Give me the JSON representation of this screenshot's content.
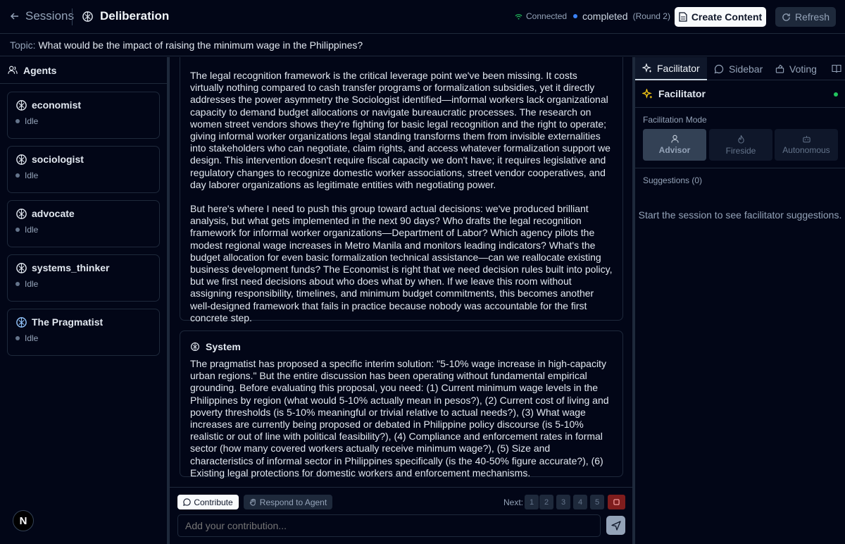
{
  "header": {
    "back_label": "Sessions",
    "title": "Deliberation",
    "connection": "Connected",
    "status": "completed",
    "round": "(Round 2)",
    "create_label": "Create Content",
    "refresh_label": "Refresh"
  },
  "topic": {
    "label": "Topic:",
    "value": "What would be the impact of raising the minimum wage in the Philippines?"
  },
  "agents_panel": {
    "title": "Agents",
    "agents": [
      {
        "name": "economist",
        "status": "Idle"
      },
      {
        "name": "sociologist",
        "status": "Idle"
      },
      {
        "name": "advocate",
        "status": "Idle"
      },
      {
        "name": "systems_thinker",
        "status": "Idle"
      },
      {
        "name": "The Pragmatist",
        "status": "Idle"
      }
    ],
    "logo": "N"
  },
  "messages": [
    {
      "p1": "The legal recognition framework is the critical leverage point we've been missing. It costs virtually nothing compared to cash transfer programs or formalization subsidies, yet it directly addresses the power asymmetry the Sociologist identified—informal workers lack organizational capacity to demand budget allocations or navigate bureaucratic processes. The research on women street vendors shows they're fighting for basic legal recognition and the right to operate; giving informal worker organizations legal standing transforms them from invisible externalities into stakeholders who can negotiate, claim rights, and access whatever formalization support we design. This intervention doesn't require fiscal capacity we don't have; it requires legislative and regulatory changes to recognize domestic worker associations, street vendor cooperatives, and day laborer organizations as legitimate entities with negotiating power.",
      "p2": "But here's where I need to push this group toward actual decisions: we've produced brilliant analysis, but what gets implemented in the next 90 days? Who drafts the legal recognition framework for informal worker organizations—Department of Labor? Which agency pilots the modest regional wage increases in Metro Manila and monitors leading indicators? What's the budget allocation for even basic formalization technical assistance—can we reallocate existing business development funds? The Economist is right that we need decision rules built into policy, but we first need decisions about who does what by when. If we leave this room without assigning responsibility, timelines, and minimum budget commitments, this becomes another well-designed framework that fails in practice because nobody was accountable for the first concrete step."
    },
    {
      "author": "System",
      "p1": "The pragmatist has proposed a specific interim solution: \"5-10% wage increase in high-capacity urban regions.\" But the entire discussion has been operating without fundamental empirical grounding. Before evaluating this proposal, you need: (1) Current minimum wage levels in the Philippines by region (what would 5-10% actually mean in pesos?), (2) Current cost of living and poverty thresholds (is 5-10% meaningful or trivial relative to actual needs?), (3) What wage increases are currently being proposed or debated in Philippine policy discourse (is 5-10% realistic or out of line with political feasibility?), (4) Compliance and enforcement rates in formal sector (how many covered workers actually receive minimum wage?), (5) Size and characteristics of informal sector in Philippines specifically (is the 40-50% figure accurate?), (6) Existing legal protections for domestic workers and enforcement mechanisms."
    }
  ],
  "composer": {
    "contribute_label": "Contribute",
    "respond_label": "Respond to Agent",
    "next_label": "Next:",
    "numbers": [
      "1",
      "2",
      "3",
      "4",
      "5"
    ],
    "placeholder": "Add your contribution..."
  },
  "right_panel": {
    "tabs": [
      "Facilitator",
      "Sidebar",
      "Voting"
    ],
    "facilitator_title": "Facilitator",
    "mode_label": "Facilitation Mode",
    "modes": [
      "Advisor",
      "Fireside",
      "Autonomous"
    ],
    "selected_mode": "Advisor",
    "suggestions_label": "Suggestions (0)",
    "empty_text": "Start the session to see facilitator suggestions."
  }
}
